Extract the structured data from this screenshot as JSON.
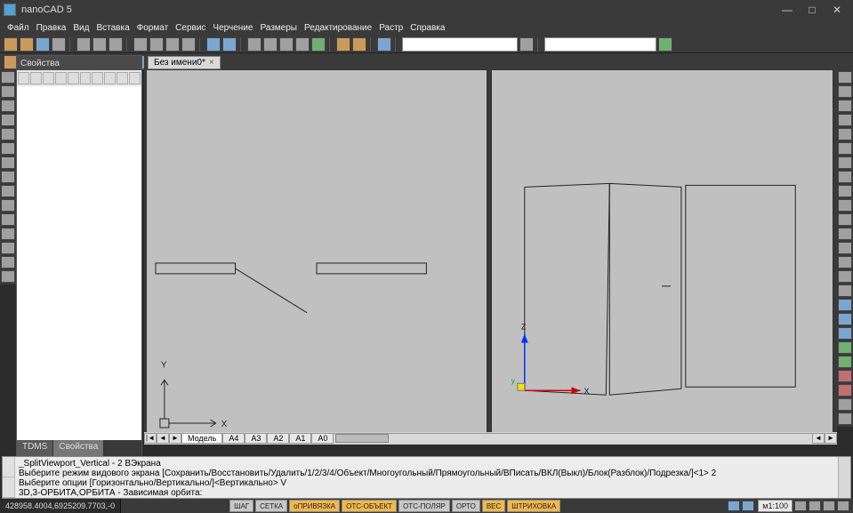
{
  "app": {
    "title": "nanoCAD 5"
  },
  "menu": [
    "Файл",
    "Правка",
    "Вид",
    "Вставка",
    "Формат",
    "Сервис",
    "Черчение",
    "Размеры",
    "Редактирование",
    "Растр",
    "Справка"
  ],
  "properties": {
    "title": "Свойства",
    "tabs": [
      "TDMS",
      "Свойства"
    ],
    "active_tab": 1
  },
  "document": {
    "tab_label": "Без имени0*"
  },
  "layout_tabs": {
    "nav": [
      "◄",
      "►"
    ],
    "tabs": [
      "Модель",
      "A4",
      "A3",
      "A2",
      "A1",
      "A0"
    ],
    "active": 0,
    "right_nav": [
      "◄",
      "►"
    ]
  },
  "command_history": "_SplitViewport_Vertical - 2 ВЭкрана\nВыберите режим видового экрана [Сохранить/Восстановить/Удалить/1/2/3/4/Объект/Многоугольный/Прямоугольный/ВПисать/ВКЛ(Выкл)/Блок(Разблок)/Подрезка/]<1> 2\nВыберите опции [Горизонтально/Вертикально/]<Вертикально> V\n3D,3-ОРБИТА,ОРБИТА - Зависимая орбита:\nНажмите  ESC или ENTER для выхода.:",
  "status": {
    "coords": "428958.4004,6925209.7703,-0",
    "toggles": [
      "ШАГ",
      "СЕТКА",
      "оПРИВЯЗКА",
      "ОТС-ОБЪЕКТ",
      "ОТС-ПОЛЯР",
      "ОРТО",
      "ВЕС",
      "ШТРИХОВКА"
    ],
    "toggles_active": [
      false,
      false,
      true,
      true,
      false,
      false,
      true,
      true
    ],
    "scale": "м1:100"
  }
}
